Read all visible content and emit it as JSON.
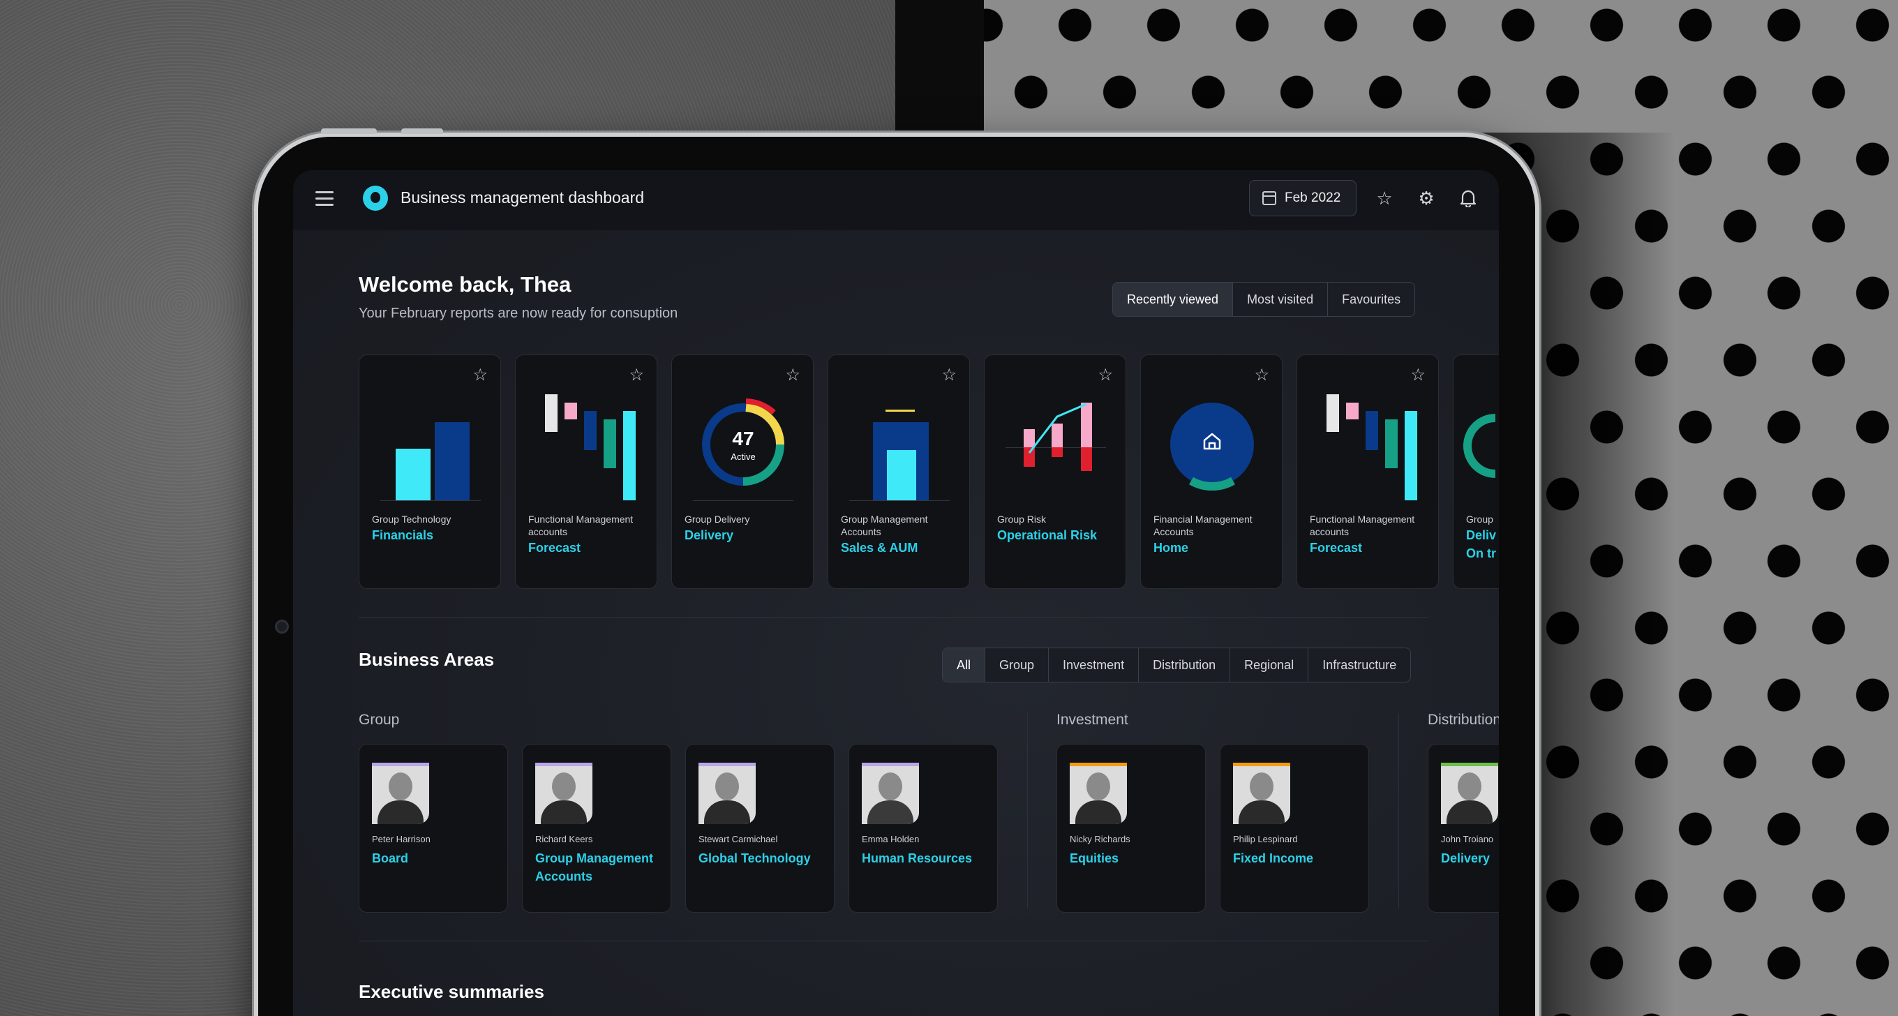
{
  "header": {
    "title": "Business management dashboard",
    "date": "Feb 2022",
    "icons": [
      "menu-icon",
      "calendar-icon",
      "star-icon",
      "gear-icon",
      "bell-icon"
    ]
  },
  "welcome": {
    "title": "Welcome back, Thea",
    "subtitle": "Your February reports are now ready for consuption"
  },
  "view_tabs": [
    "Recently viewed",
    "Most visited",
    "Favourites"
  ],
  "reports": [
    {
      "category": "Group Technology",
      "title": "Financials"
    },
    {
      "category": "Functional Management accounts",
      "title": "Forecast"
    },
    {
      "category": "Group Delivery",
      "title": "Delivery",
      "gauge_value": "47",
      "gauge_label": "Active"
    },
    {
      "category": "Group Management Accounts",
      "title": "Sales & AUM"
    },
    {
      "category": "Group Risk",
      "title": "Operational Risk"
    },
    {
      "category": "Financial Management Accounts",
      "title": "Home"
    },
    {
      "category": "Functional Management accounts",
      "title": "Forecast"
    },
    {
      "category": "Group",
      "title": "Deliv",
      "title2": "On tr"
    }
  ],
  "business_areas": {
    "title": "Business Areas",
    "tabs": [
      "All",
      "Group",
      "Investment",
      "Distribution",
      "Regional",
      "Infrastructure"
    ],
    "groups": [
      {
        "label": "Group",
        "people": [
          {
            "name": "Peter Harrison",
            "role": "Board"
          },
          {
            "name": "Richard Keers",
            "role": "Group Management Accounts"
          },
          {
            "name": "Stewart Carmichael",
            "role": "Global Technology"
          },
          {
            "name": "Emma Holden",
            "role": "Human Resources"
          }
        ]
      },
      {
        "label": "Investment",
        "people": [
          {
            "name": "Nicky Richards",
            "role": "Equities"
          },
          {
            "name": "Philip Lespinard",
            "role": "Fixed Income"
          }
        ]
      },
      {
        "label": "Distribution",
        "people": [
          {
            "name": "John Troiano",
            "role": "Delivery"
          }
        ]
      }
    ]
  },
  "exec_summaries": {
    "title": "Executive summaries"
  },
  "colors": {
    "accent": "#2bd1e8",
    "navy": "#0a3a8a",
    "pink": "#f7a9c9",
    "red": "#e0202f",
    "green": "#16a085",
    "yellow": "#f2d64b"
  }
}
